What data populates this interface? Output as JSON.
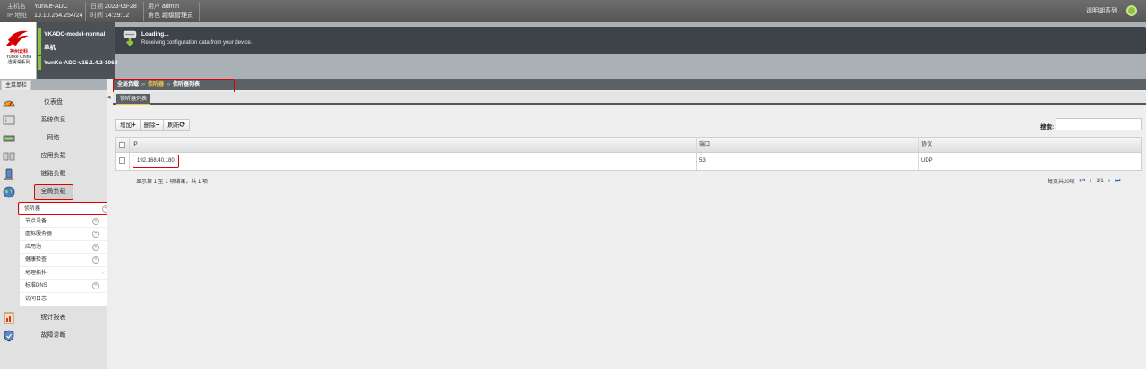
{
  "topbar": {
    "hostname_label": "主机名",
    "hostname_value": "YunKe-ADC",
    "ip_label": "IP 地址",
    "ip_value": "10.10.254.254/24",
    "date_label": "日期",
    "date_value": "2023-09-28",
    "time_label": "时间",
    "time_value": "14:29:12",
    "user_label": "用户",
    "user_value": "admin",
    "role_label": "角色",
    "role_value": "超级管理员",
    "right_text": "透明湖系列"
  },
  "header": {
    "logo_cn": "神州云科",
    "logo_en": "Yunke China",
    "logo_series": "透明湖系列",
    "device_model": "YKADC-model-normal",
    "device_mode": "单机",
    "device_version": "YunKe-ADC-v15.1.4.2-1060",
    "status_title": "Loading...",
    "status_message": "Receiving configuration data from your device."
  },
  "sidebar": {
    "tab_label": "主菜单栏",
    "items": [
      {
        "label": "仪表盘",
        "icon": "dashboard-icon"
      },
      {
        "label": "系统信息",
        "icon": "system-info-icon"
      },
      {
        "label": "网络",
        "icon": "network-icon"
      },
      {
        "label": "应用负载",
        "icon": "app-load-icon"
      },
      {
        "label": "链路负载",
        "icon": "link-load-icon"
      },
      {
        "label": "全局负载",
        "icon": "globe-icon"
      }
    ],
    "submenu": [
      {
        "label": "侦听器",
        "has_plus": true
      },
      {
        "label": "节点设备",
        "has_plus": true
      },
      {
        "label": "虚拟服务器",
        "has_plus": true
      },
      {
        "label": "应用池",
        "has_plus": true
      },
      {
        "label": "健康检查",
        "has_plus": true
      },
      {
        "label": "地理拓扑",
        "has_arrow": true
      },
      {
        "label": "标准DNS",
        "has_plus": true
      },
      {
        "label": "访问日志"
      }
    ],
    "bottom_items": [
      {
        "label": "统计报表",
        "icon": "report-icon"
      },
      {
        "label": "故障诊断",
        "icon": "diagnose-icon"
      }
    ]
  },
  "breadcrumb": {
    "level1": "全局负载",
    "level2": "侦听器",
    "level3": "侦听器列表",
    "separator": "››"
  },
  "page_tab": "侦听器列表",
  "toolbar": {
    "add_label": "增加",
    "add_glyph": "+",
    "delete_label": "删除",
    "delete_glyph": "−",
    "refresh_label": "刷新",
    "refresh_glyph": "⟳"
  },
  "search": {
    "label": "搜索:",
    "value": ""
  },
  "table": {
    "columns": [
      "IP",
      "端口",
      "协议"
    ],
    "rows": [
      {
        "ip": "192.168.40.180",
        "port": "53",
        "protocol": "UDP"
      }
    ]
  },
  "footer": {
    "info": "显示第 1 至 1 项结果，共 1 项",
    "per_page": "每页共20项",
    "page_indicator": "1/1"
  },
  "colors": {
    "accent_green": "#8fc23f",
    "highlight_red": "#e00000",
    "breadcrumb_mid": "#f6c343"
  }
}
